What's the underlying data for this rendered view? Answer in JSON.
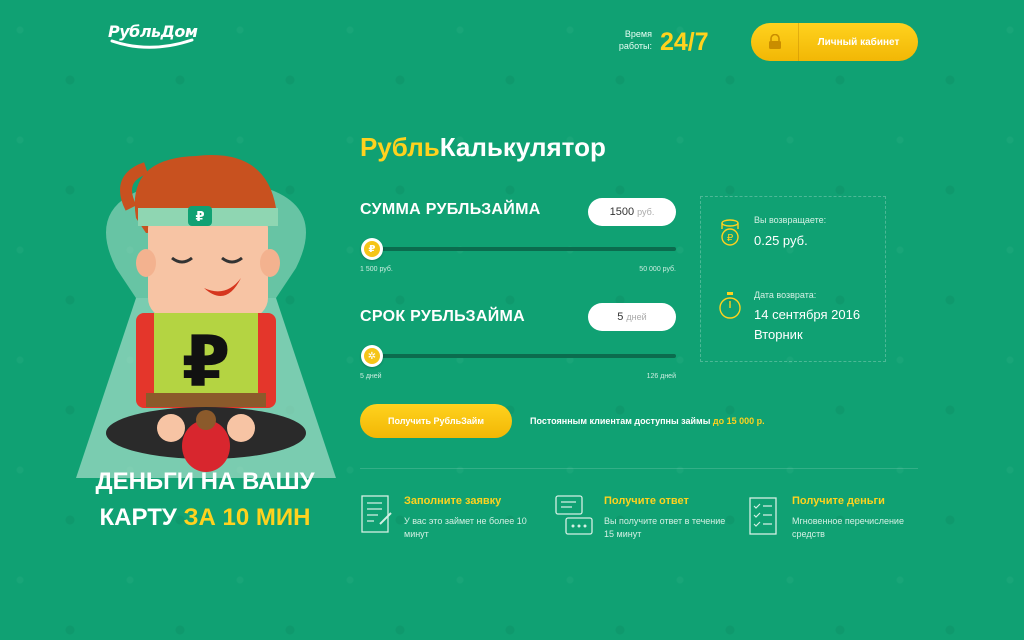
{
  "logo": {
    "text": "РубльДом"
  },
  "header": {
    "work_label": "Время работы:",
    "work_value": "24/7",
    "cabinet_label": "Личный кабинет"
  },
  "colors": {
    "background": "#10a173",
    "accent": "#ffd21e",
    "track": "#0b6c4e"
  },
  "promo": {
    "line1": "Деньги на вашу",
    "line2_plain": "карту ",
    "line2_accent": "за 10 мин"
  },
  "calculator": {
    "title_accent": "Рубль",
    "title_plain": "Калькулятор",
    "amount": {
      "label": "СУММА РУБЛЬЗАЙМА",
      "value": "1500",
      "unit": "руб.",
      "min_label": "1 500 руб.",
      "max_label": "50 000 руб.",
      "knob_icon": "ruble-coin-icon"
    },
    "term": {
      "label": "СРОК РУБЛЬЗАЙМА",
      "value": "5",
      "unit": "дней",
      "min_label": "5 дней",
      "max_label": "126 дней",
      "knob_icon": "gear-coin-icon"
    },
    "returns": {
      "label": "Вы возвращаете:",
      "value": "0.25 руб.",
      "icon": "coins-icon"
    },
    "return_date": {
      "label": "Дата возврата:",
      "date": "14 сентября 2016",
      "weekday": "Вторник",
      "icon": "stopwatch-icon"
    },
    "submit_label": "Получить РубльЗайм",
    "regular_text": "Постоянным клиентам доступны займы ",
    "regular_accent": "до 15 000 р."
  },
  "steps": [
    {
      "title": "Заполните заявку",
      "text": "У вас это займет не более 10 минут",
      "icon": "form-icon"
    },
    {
      "title": "Получите ответ",
      "text": "Вы получите ответ в течение 15 минут",
      "icon": "chat-icon"
    },
    {
      "title": "Получите деньги",
      "text": "Мгновенное перечисление средств",
      "icon": "checklist-icon"
    }
  ]
}
